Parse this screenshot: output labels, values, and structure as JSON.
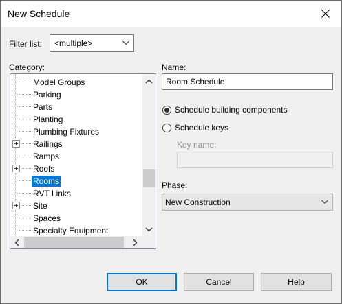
{
  "window": {
    "title": "New Schedule"
  },
  "filter": {
    "label": "Filter list:",
    "value": "<multiple>"
  },
  "category": {
    "label": "Category:",
    "items": [
      {
        "label": "Model Groups",
        "expandable": false,
        "selected": false
      },
      {
        "label": "Parking",
        "expandable": false,
        "selected": false
      },
      {
        "label": "Parts",
        "expandable": false,
        "selected": false
      },
      {
        "label": "Planting",
        "expandable": false,
        "selected": false
      },
      {
        "label": "Plumbing Fixtures",
        "expandable": false,
        "selected": false
      },
      {
        "label": "Railings",
        "expandable": true,
        "selected": false
      },
      {
        "label": "Ramps",
        "expandable": false,
        "selected": false
      },
      {
        "label": "Roofs",
        "expandable": true,
        "selected": false
      },
      {
        "label": "Rooms",
        "expandable": false,
        "selected": true
      },
      {
        "label": "RVT Links",
        "expandable": false,
        "selected": false
      },
      {
        "label": "Site",
        "expandable": true,
        "selected": false
      },
      {
        "label": "Spaces",
        "expandable": false,
        "selected": false
      },
      {
        "label": "Specialty Equipment",
        "expandable": false,
        "selected": false
      }
    ]
  },
  "name": {
    "label": "Name:",
    "value": "Room Schedule"
  },
  "schedule_type": {
    "options": [
      {
        "label": "Schedule building components",
        "checked": true
      },
      {
        "label": "Schedule keys",
        "checked": false
      }
    ]
  },
  "key_name": {
    "label": "Key name:",
    "value": ""
  },
  "phase": {
    "label": "Phase:",
    "value": "New Construction"
  },
  "buttons": {
    "ok": "OK",
    "cancel": "Cancel",
    "help": "Help"
  },
  "colors": {
    "selection": "#0078d7",
    "dialog_bg": "#f0f0f0",
    "title_bg": "#ffffff"
  }
}
